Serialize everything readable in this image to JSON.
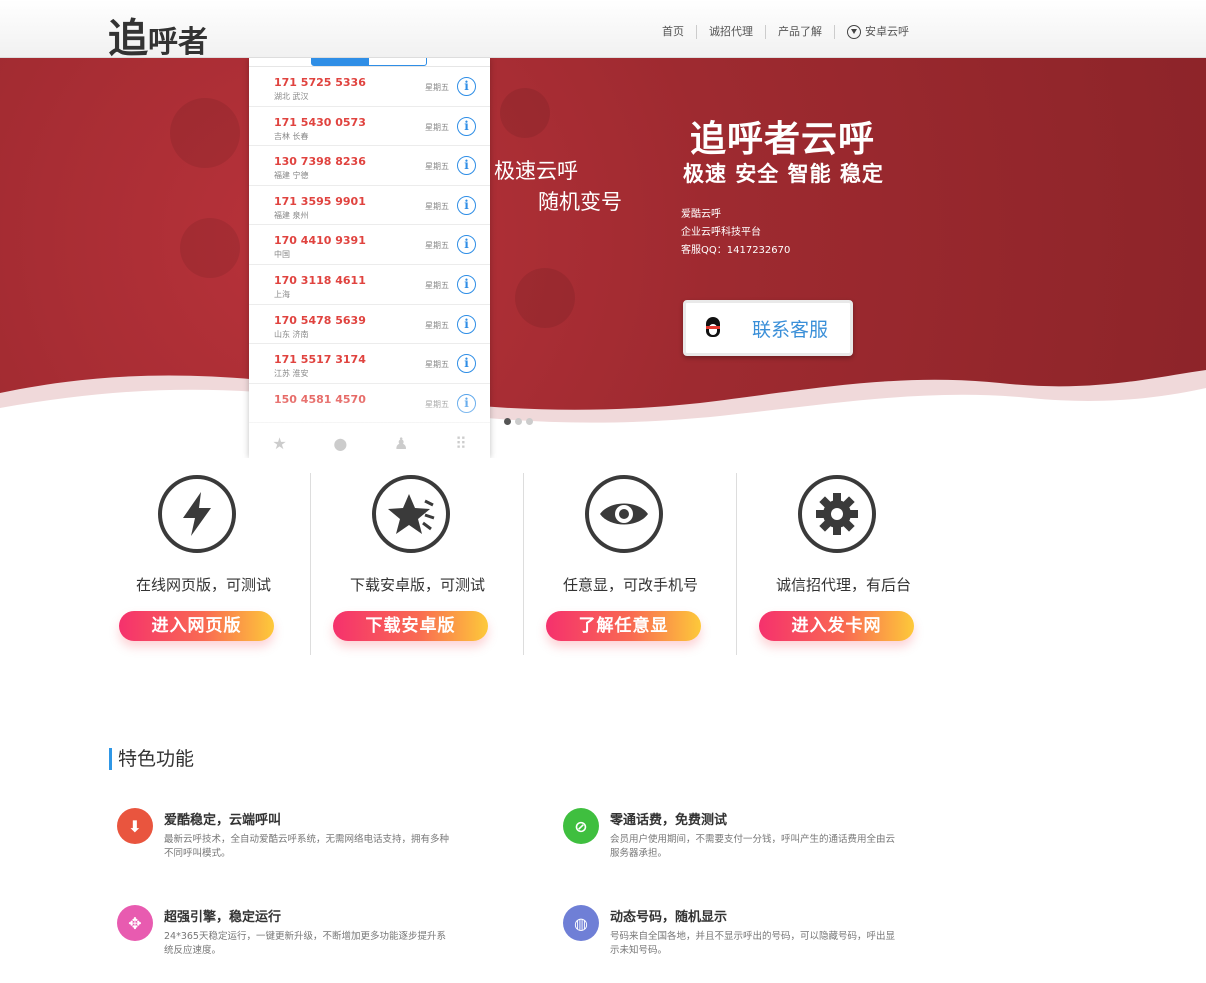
{
  "header": {
    "logo_big": "追",
    "logo_small": "呼者",
    "nav": [
      {
        "label": "首页"
      },
      {
        "label": "诚招代理"
      },
      {
        "label": "产品了解"
      },
      {
        "label": "安卓云呼",
        "icon": "download-circle-icon"
      }
    ]
  },
  "banner": {
    "call_log": [
      {
        "number": "171 5725 5336",
        "location": "湖北 武汉",
        "day": "星期五"
      },
      {
        "number": "171 5430 0573",
        "location": "吉林 长春",
        "day": "星期五"
      },
      {
        "number": "130 7398 8236",
        "location": "福建 宁德",
        "day": "星期五"
      },
      {
        "number": "171 3595 9901",
        "location": "福建 泉州",
        "day": "星期五"
      },
      {
        "number": "170 4410 9391",
        "location": "中国",
        "day": "星期五"
      },
      {
        "number": "170 3118 4611",
        "location": "上海",
        "day": "星期五"
      },
      {
        "number": "170 5478 5639",
        "location": "山东 济南",
        "day": "星期五"
      },
      {
        "number": "171 5517 3174",
        "location": "江苏 淮安",
        "day": "星期五"
      },
      {
        "number": "150 4581 4570",
        "location": "",
        "day": "星期五"
      }
    ],
    "slogan_1": "极速云呼",
    "slogan_2": "随机变号",
    "title": "追呼者云呼",
    "subtitle": "极速 安全 智能 稳定",
    "info": [
      "爱酷云呼",
      "企业云呼科技平台",
      "客服QQ：1417232670"
    ],
    "contact_button": "联系客服",
    "slide_count": 3,
    "active_slide": 1
  },
  "features": [
    {
      "title": "在线网页版，可测试",
      "button": "进入网页版",
      "icon": "lightning-icon"
    },
    {
      "title": "下载安卓版，可测试",
      "button": "下载安卓版",
      "icon": "star-icon"
    },
    {
      "title": "任意显，可改手机号",
      "button": "了解任意显",
      "icon": "eye-icon"
    },
    {
      "title": "诚信招代理，有后台",
      "button": "进入发卡网",
      "icon": "gear-icon"
    }
  ],
  "special": {
    "title": "特色功能",
    "items": [
      {
        "title": "爱酷稳定，云端呼叫",
        "desc": "最新云呼技术，全自动爱酷云呼系统，无需网络电话支持，拥有多种不同呼叫模式。",
        "color": "#e9553e",
        "icon": "download-icon"
      },
      {
        "title": "零通话费，免费测试",
        "desc": "会员用户使用期间，不需要支付一分钱，呼叫产生的通话费用全由云服务器承担。",
        "color": "#3fbf3f",
        "icon": "no-sign-icon"
      },
      {
        "title": "超强引擎，稳定运行",
        "desc": "24*365天稳定运行，一键更新升级，不断增加更多功能逐步提升系统反应速度。",
        "color": "#e85bb0",
        "icon": "move-icon"
      },
      {
        "title": "动态号码，随机显示",
        "desc": "号码来自全国各地，并且不显示呼出的号码，可以隐藏号码，呼出显示未知号码。",
        "color": "#6f7fd6",
        "icon": "globe-icon"
      }
    ]
  }
}
